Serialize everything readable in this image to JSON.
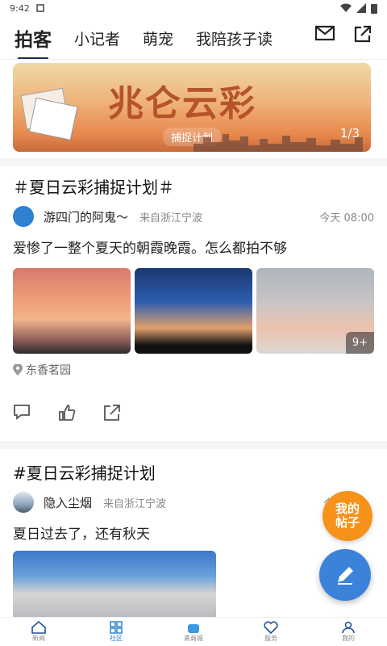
{
  "status": {
    "time": "9:42"
  },
  "tabs": [
    {
      "label": "拍客",
      "active": true
    },
    {
      "label": "小记者"
    },
    {
      "label": "萌宠"
    },
    {
      "label": "我陪孩子读"
    }
  ],
  "banner": {
    "title": "兆仑云彩",
    "subtitle": "捕捉计划",
    "page": "1/3"
  },
  "post1": {
    "title": "＃夏日云彩捕捉计划＃",
    "author": "游四门的阿鬼～",
    "from": "来自浙江宁波",
    "time": "今天 08:00",
    "text": "爱惨了一整个夏天的朝霞晚霞。怎么都拍不够",
    "more": "9+",
    "location": "东香茗园"
  },
  "post2": {
    "title": "#夏日云彩捕捉计划",
    "author": "隐入尘烟",
    "from": "来自浙江宁波",
    "time": "今",
    "text": "夏日过去了，还有秋天"
  },
  "fab": {
    "my_posts": "我的\n帖子"
  },
  "bottom_nav": [
    {
      "label": "新闻"
    },
    {
      "label": "社区",
      "active": true
    },
    {
      "label": "甬商城"
    },
    {
      "label": "服务"
    },
    {
      "label": "我的"
    }
  ],
  "colors": {
    "accent": "#2f80d1",
    "orange": "#f6911a",
    "fab_blue": "#3b82db"
  }
}
